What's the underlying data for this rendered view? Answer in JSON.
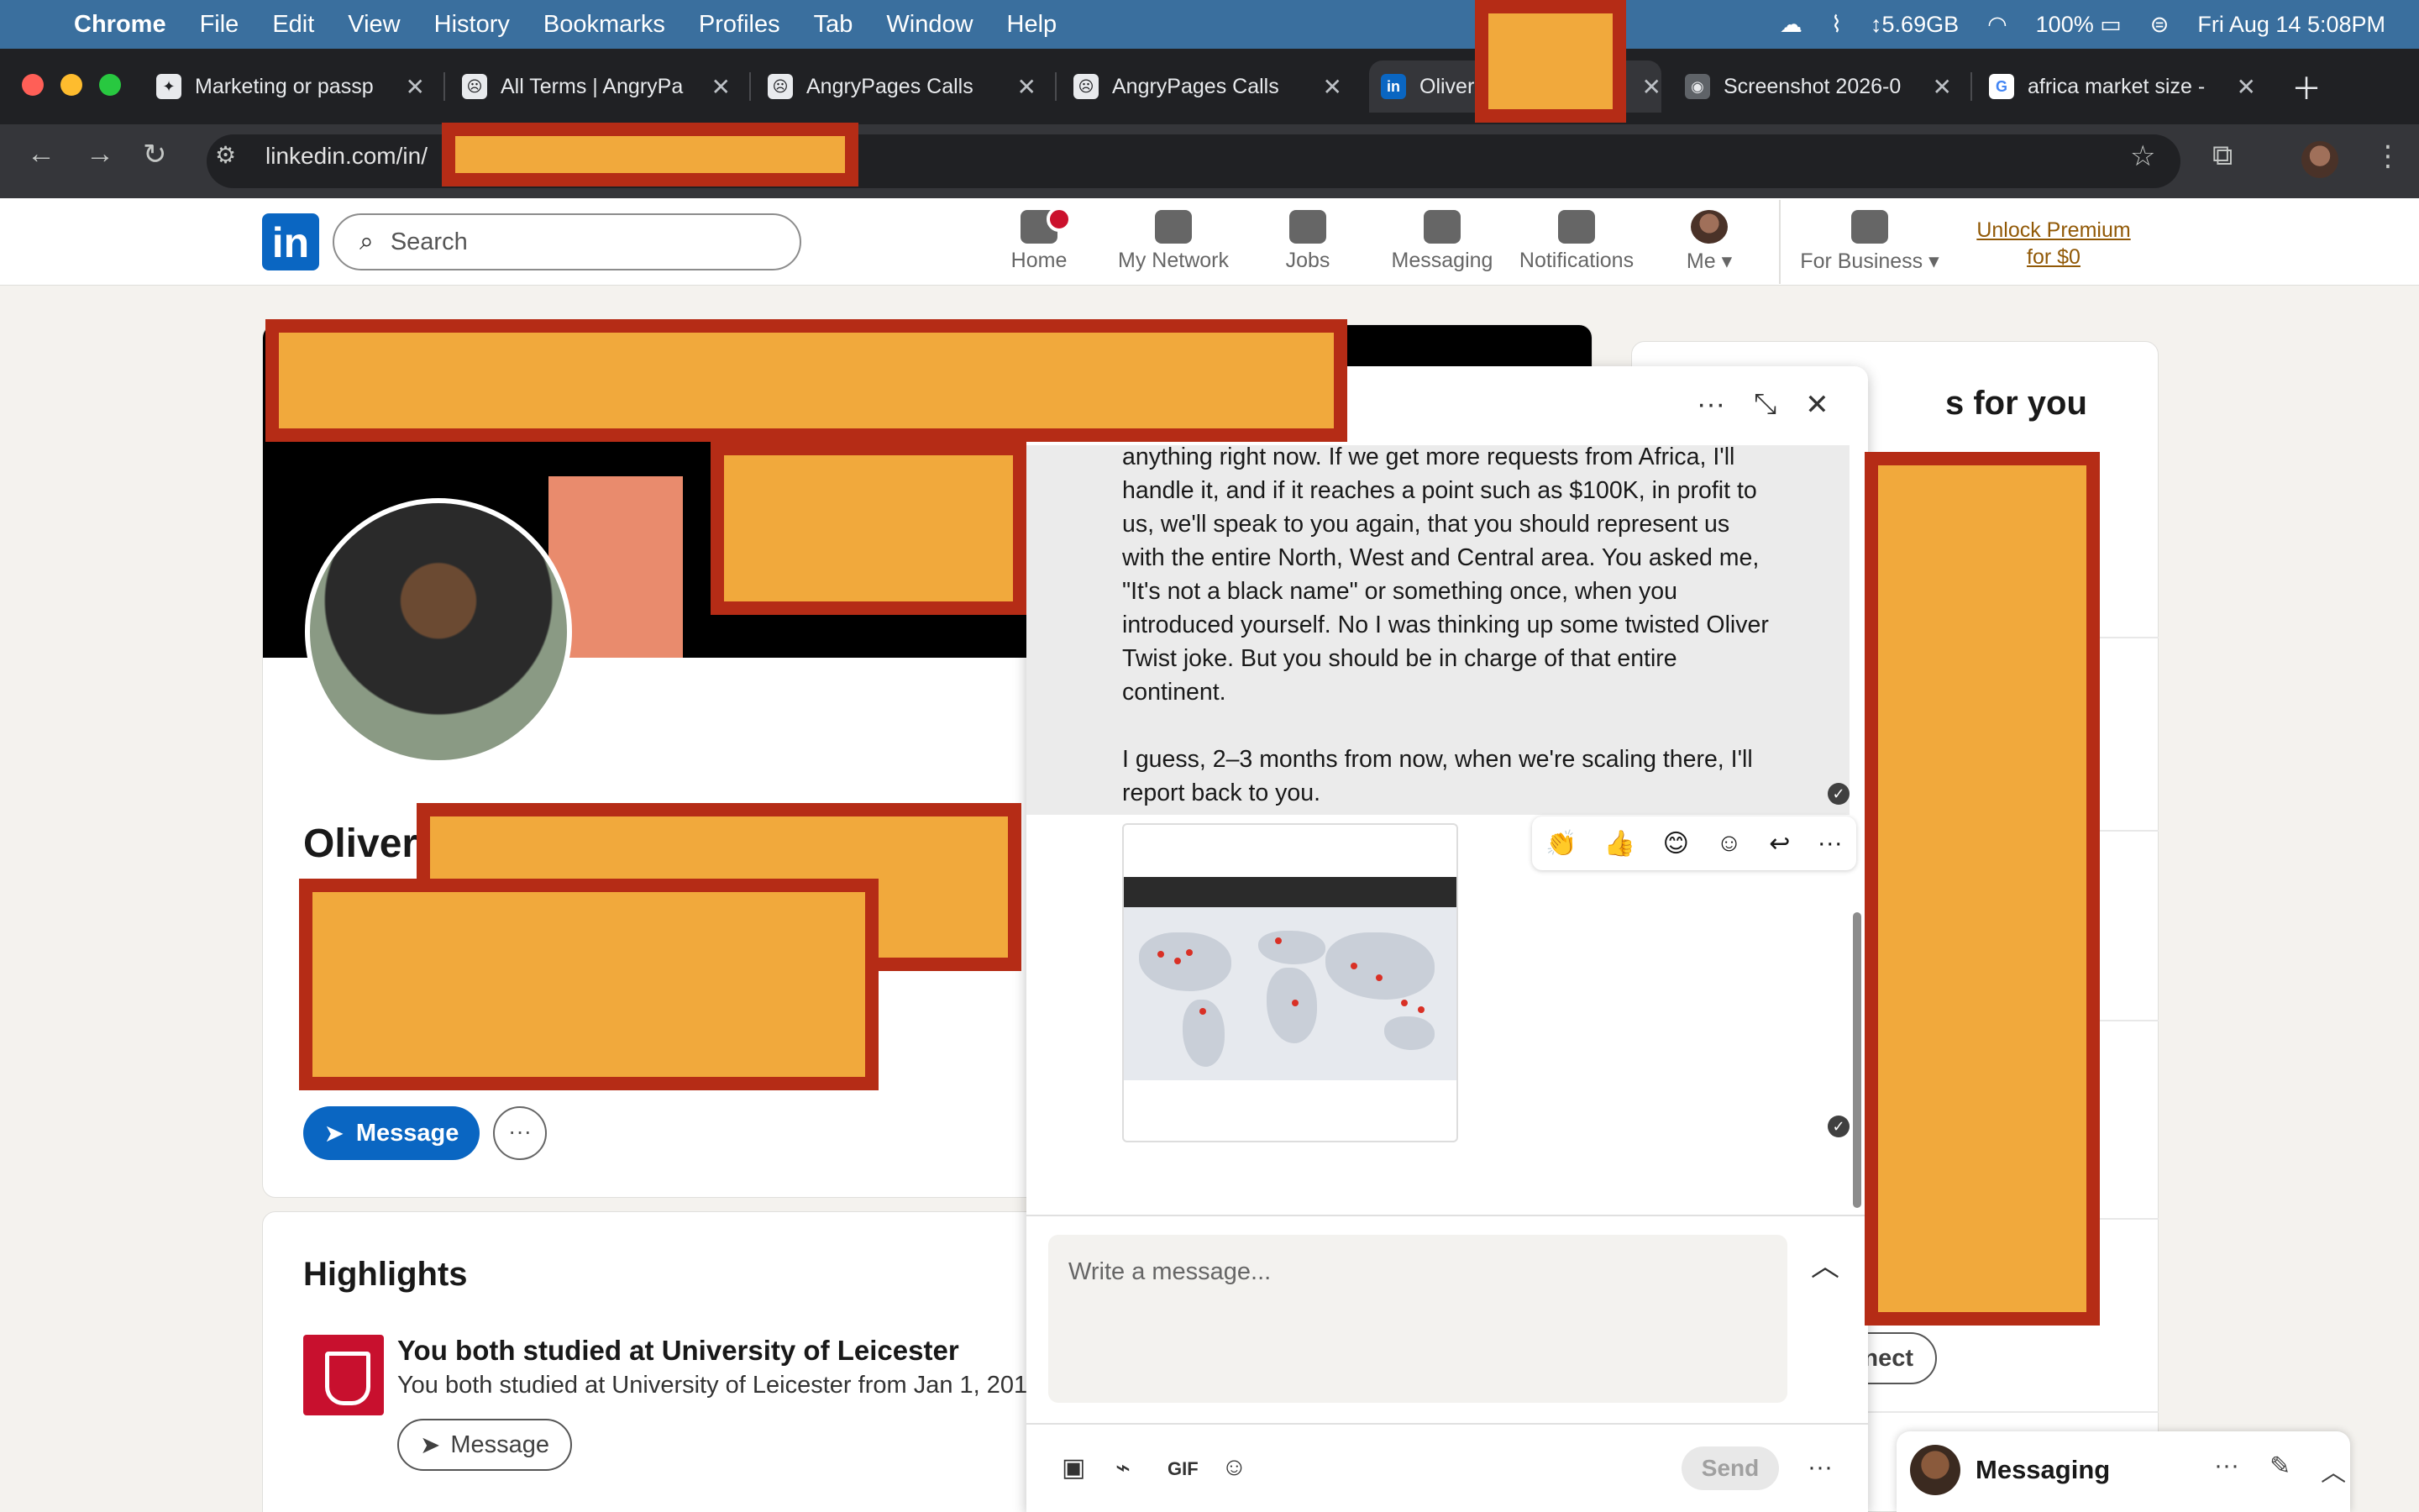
{
  "menubar": {
    "app": "Chrome",
    "items": [
      "File",
      "Edit",
      "View",
      "History",
      "Bookmarks",
      "Profiles",
      "Tab",
      "Window",
      "Help"
    ],
    "storage": "5.69GB",
    "battery": "100%",
    "datetime": "Fri Aug 14  5:08PM"
  },
  "browser": {
    "tabs": [
      {
        "label": "Marketing or passp",
        "fav": "✦"
      },
      {
        "label": "All Terms | AngryPa",
        "fav": "☹"
      },
      {
        "label": "AngryPages Calls",
        "fav": "☹"
      },
      {
        "label": "AngryPages Calls",
        "fav": "☹"
      },
      {
        "label": "Oliver",
        "fav": "in"
      },
      {
        "label": "Screenshot 2026-0",
        "fav": "◉"
      },
      {
        "label": "africa market size -",
        "fav": "G"
      }
    ],
    "url": "linkedin.com/in/"
  },
  "linkedin": {
    "logo": "in",
    "search_placeholder": "Search",
    "nav": [
      "Home",
      "My Network",
      "Jobs",
      "Messaging",
      "Notifications",
      "Me",
      "For Business"
    ],
    "premium": "Unlock Premium for $0"
  },
  "profile": {
    "name": "Oliver",
    "message_button": "Message",
    "more_button": "···"
  },
  "highlights": {
    "title": "Highlights",
    "headline": "You both studied at University of Leicester",
    "subtext": "You both studied at University of Leicester from Jan 1, 201",
    "message_button": "Message"
  },
  "right_column": {
    "title_fragment": "s for you",
    "connect_button": "Connect"
  },
  "chat": {
    "message_text": "anything right now. If we get more requests from Africa, I'll handle it, and if it reaches a point such as $100K, in profit to us, we'll speak to you again, that you should represent us with the entire North, West and Central area. You asked me, \"It's not a black name\" or something once, when you introduced yourself. No I was thinking up some twisted Oliver Twist joke. But you should be in charge of that entire continent.\n\nI guess, 2–3 months from now, when we're scaling there, I'll report back to you.",
    "reactions": [
      "👏",
      "👍",
      "😊",
      "☺",
      "↩",
      "···"
    ],
    "compose_placeholder": "Write a message...",
    "send_label": "Send",
    "tool_gif": "GIF"
  },
  "messaging_bar": {
    "label": "Messaging"
  },
  "colors": {
    "linkedin_blue": "#0a66c2",
    "redaction_fill": "#f1a93c",
    "redaction_border": "#b52c16",
    "menubar": "#3a6f9e"
  }
}
